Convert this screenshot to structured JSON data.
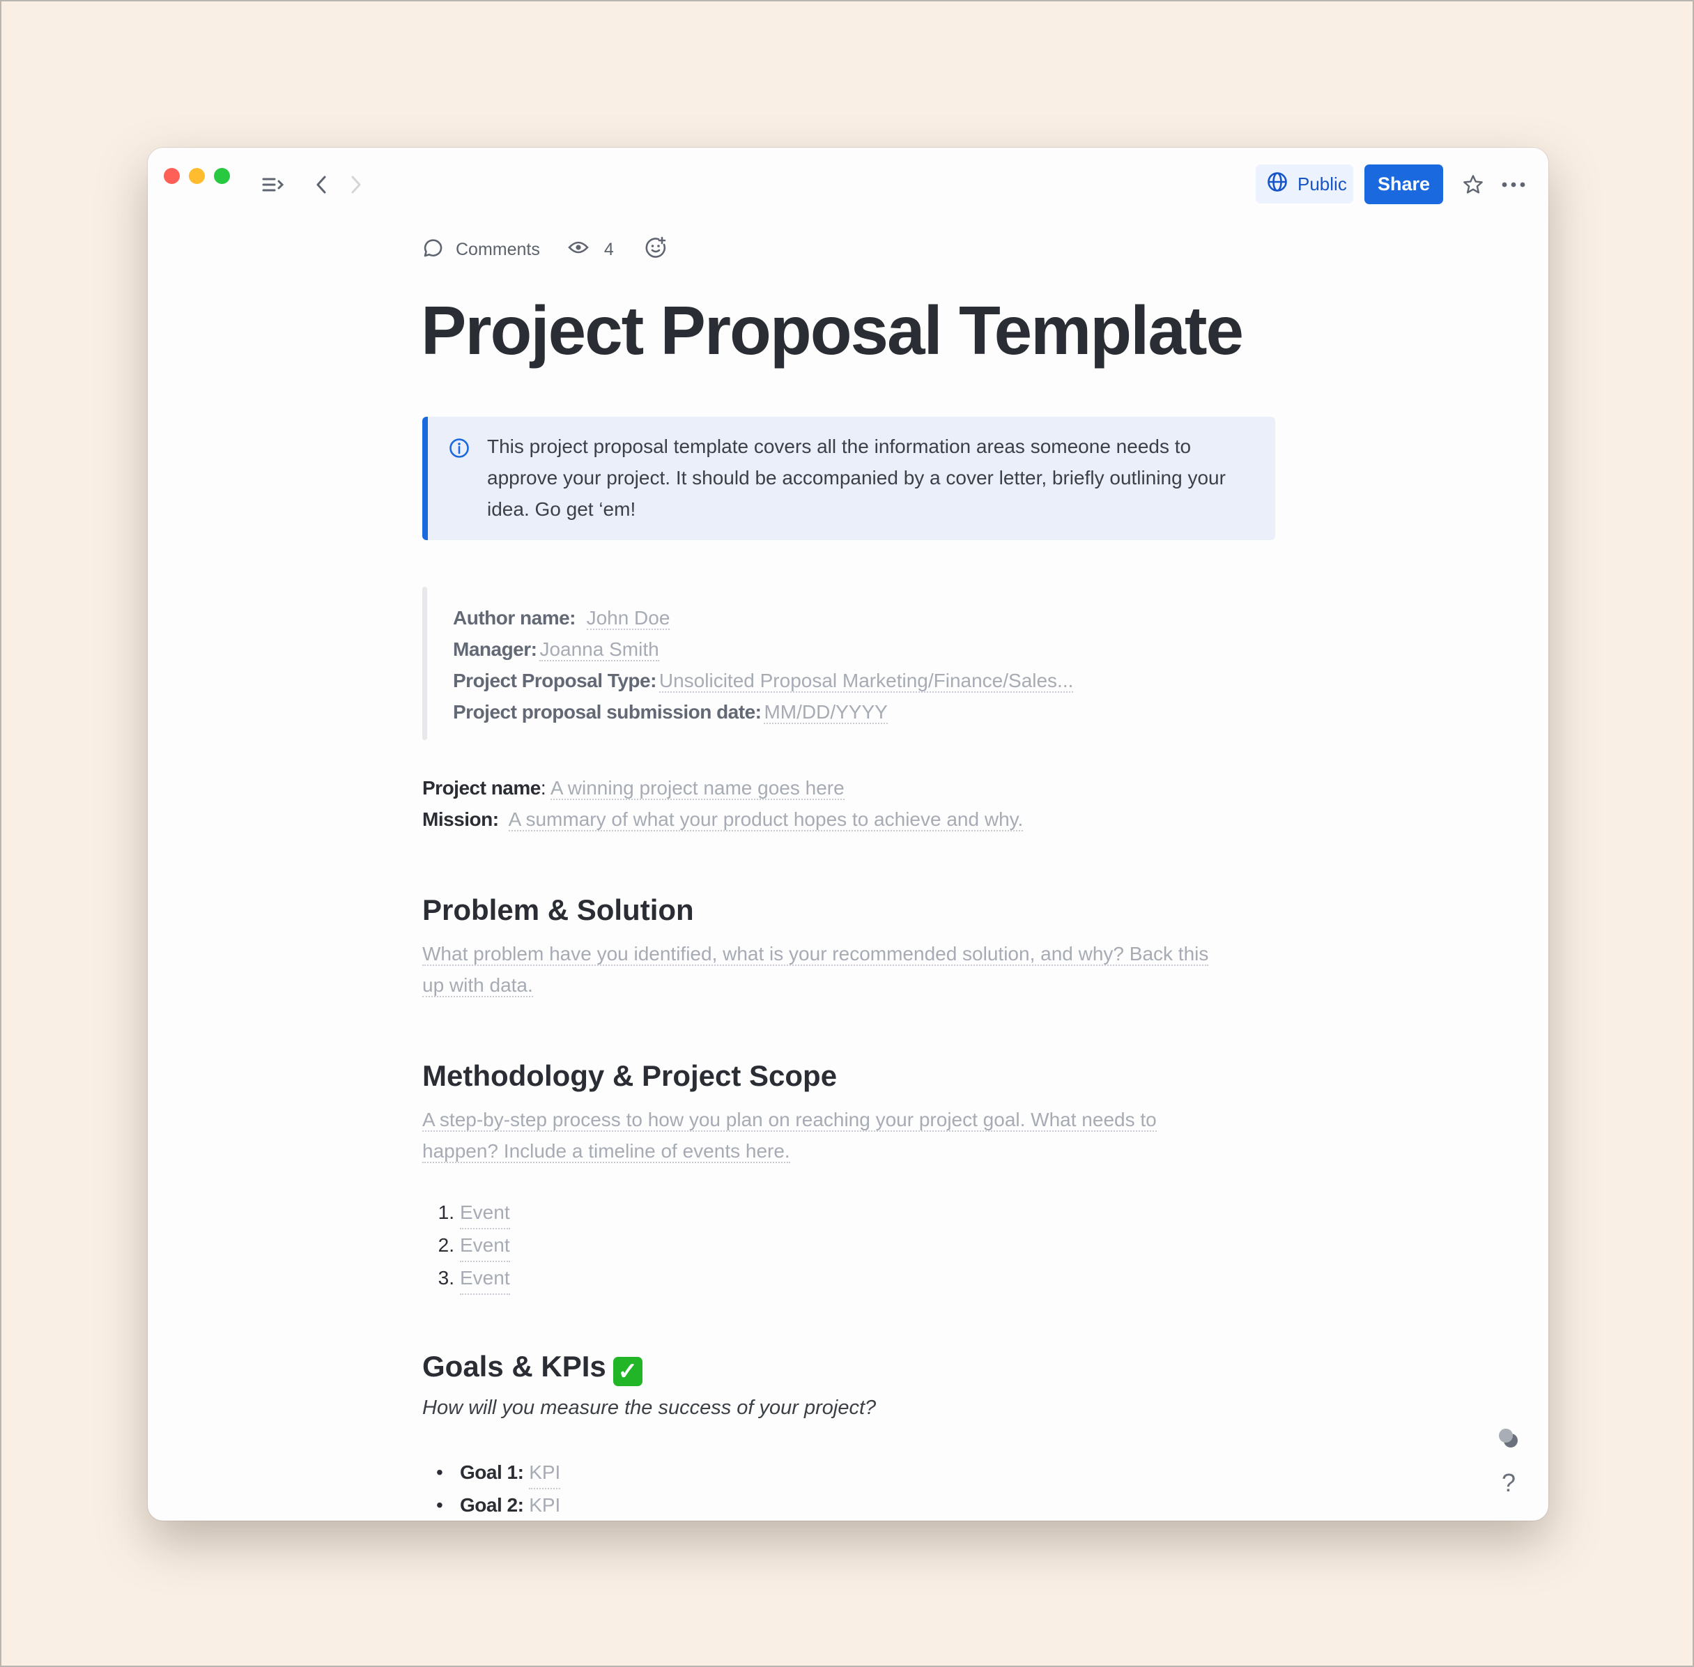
{
  "toolbar": {
    "public_label": "Public",
    "share_label": "Share",
    "icons": {
      "sidebar": "sidebar-toggle-icon",
      "back": "chevron-left-icon",
      "forward": "chevron-right-icon",
      "globe": "globe-icon",
      "star": "star-icon",
      "more": "more-horizontal-icon"
    }
  },
  "meta": {
    "comments_label": "Comments",
    "views_count": "4",
    "icons": {
      "comments": "comment-bubble-icon",
      "views": "eye-icon",
      "reaction": "add-reaction-icon"
    }
  },
  "document": {
    "title": "Project Proposal Template",
    "callout": {
      "icon": "info-icon",
      "text": "This project proposal template covers all the information areas someone needs to approve your project. It should be accompanied by a cover letter, briefly outlining your idea. Go get ‘em!"
    },
    "details": [
      {
        "label": "Author name:",
        "value": "John Doe"
      },
      {
        "label": "Manager:",
        "value": "Joanna Smith"
      },
      {
        "label": "Project Proposal Type:",
        "value": "Unsolicited Proposal Marketing/Finance/Sales..."
      },
      {
        "label": "Project proposal submission date:",
        "value": "MM/DD/YYYY"
      }
    ],
    "project_name": {
      "label": "Project name",
      "sep": ":",
      "value": "A winning project name goes here"
    },
    "mission": {
      "label": "Mission:",
      "value": "A summary of what your product hopes to achieve and why."
    },
    "sections": [
      {
        "heading": "Problem & Solution",
        "placeholder_lines": [
          "What problem have you identified, what is your recommended solution, and why? Back this",
          "up with data."
        ]
      },
      {
        "heading": "Methodology & Project Scope",
        "placeholder_lines": [
          "A step-by-step process to how you plan on reaching your project goal. What needs to",
          "happen? Include a timeline of events here."
        ],
        "events": [
          {
            "num": "1.",
            "value": "Event"
          },
          {
            "num": "2.",
            "value": "Event"
          },
          {
            "num": "3.",
            "value": "Event"
          }
        ]
      },
      {
        "heading": "Goals & KPIs",
        "heading_emoji": "✓",
        "subtitle": "How will you measure the success of your project?",
        "goals": [
          {
            "label": "Goal 1:",
            "value": "KPI"
          },
          {
            "label": "Goal 2:",
            "value": "KPI"
          }
        ]
      }
    ]
  },
  "floating": {
    "help_label": "?",
    "icons": {
      "toggle": "theme-toggle-icon",
      "help": "help-icon"
    }
  },
  "colors": {
    "accent": "#1a69de",
    "callout_bg": "#ebeffa",
    "page_bg": "#f9efe5",
    "placeholder": "#a6abb4",
    "text": "#2a2d33"
  }
}
